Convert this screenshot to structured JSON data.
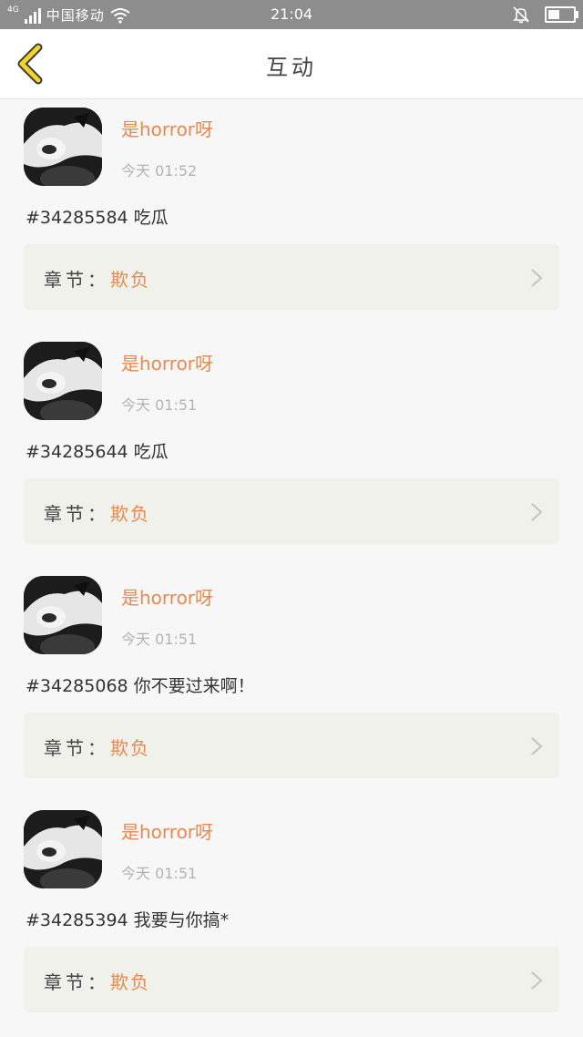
{
  "status_bar": {
    "network": "4G",
    "carrier": "中国移动",
    "time": "21:04",
    "battery_level": 0.45
  },
  "nav": {
    "title": "互动"
  },
  "accent_color": "#e8894f",
  "items": [
    {
      "user": "是horror呀",
      "time": "今天 01:52",
      "content": "#34285584 吃瓜",
      "chapter_label": "章节：",
      "chapter_name": "欺负"
    },
    {
      "user": "是horror呀",
      "time": "今天 01:51",
      "content": "#34285644 吃瓜",
      "chapter_label": "章节：",
      "chapter_name": "欺负"
    },
    {
      "user": "是horror呀",
      "time": "今天 01:51",
      "content": "#34285068 你不要过来啊！",
      "chapter_label": "章节：",
      "chapter_name": "欺负"
    },
    {
      "user": "是horror呀",
      "time": "今天 01:51",
      "content": "#34285394 我要与你搞*",
      "chapter_label": "章节：",
      "chapter_name": "欺负"
    }
  ]
}
